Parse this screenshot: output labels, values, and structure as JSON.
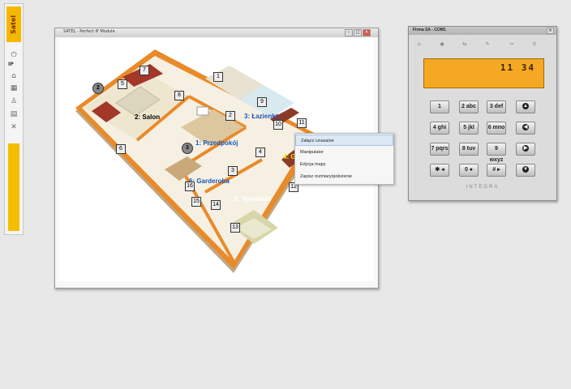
{
  "sidebar": {
    "logo": "Satel",
    "ip_label": "IP"
  },
  "map_window": {
    "title": "SATEL - Perfect IP Module",
    "rooms": {
      "salon": "2: Salon",
      "przedpokoj": "1: Przedpokój",
      "lazienka": "3: Łazienka",
      "garderoba": "6: Garderoba",
      "sypialnia": "5: Sypialnia",
      "hidden": "4: G"
    },
    "zone_numbers": [
      "1",
      "2",
      "3",
      "4",
      "5",
      "6",
      "7",
      "8",
      "9",
      "10",
      "11",
      "12",
      "13",
      "14",
      "15",
      "16"
    ],
    "circle_labels": [
      "2",
      "3"
    ]
  },
  "context_menu": {
    "items": [
      "Załącz czuwanie",
      "Manipulator",
      "Edycja mapy",
      "Zapisz rozmiary/położenie"
    ]
  },
  "keypad": {
    "title": "Firma SA - COM1",
    "display": "11 34",
    "brand": "INTEGRA",
    "keys": [
      [
        "1",
        "2 abc",
        "3 def"
      ],
      [
        "4 ghi",
        "5 jkl",
        "6 mno"
      ],
      [
        "7 pqrs",
        "8 tuv",
        "9 wxyz"
      ],
      [
        "✱ ◂",
        "0 ●",
        "# ▸"
      ]
    ],
    "nav": [
      "▲",
      "◀",
      "▶",
      "▼"
    ]
  }
}
